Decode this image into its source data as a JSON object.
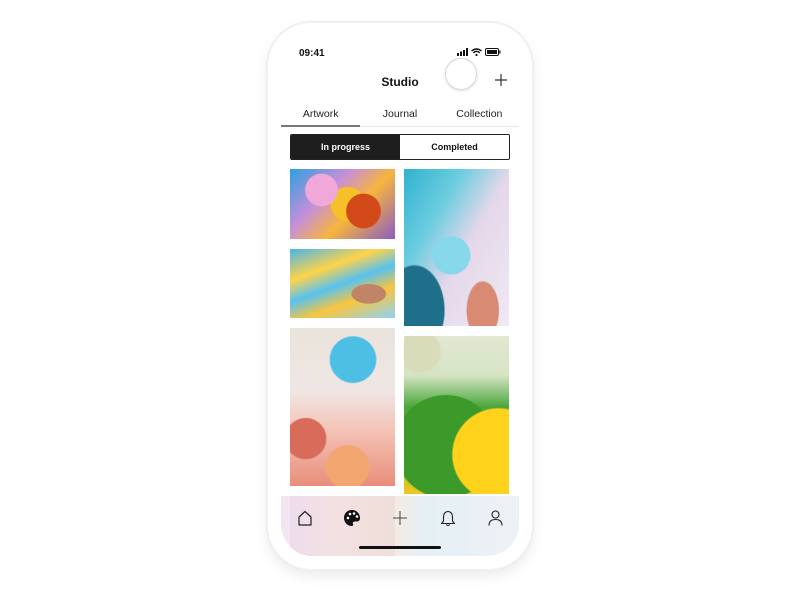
{
  "status_bar": {
    "time": "09:41"
  },
  "navbar": {
    "title": "Studio",
    "add_icon": "plus-icon"
  },
  "tabs": [
    {
      "label": "Artwork",
      "active": true
    },
    {
      "label": "Journal",
      "active": false
    },
    {
      "label": "Collection",
      "active": false
    }
  ],
  "segmented_control": {
    "options": [
      {
        "label": "In progress",
        "active": true
      },
      {
        "label": "Completed",
        "active": false
      }
    ]
  },
  "gallery": {
    "items": [
      {
        "description": "colorful oil bubbles pink yellow blue"
      },
      {
        "description": "blue and yellow liquid waves"
      },
      {
        "description": "teal bubble on pale background"
      },
      {
        "description": "blue and coral bubbles"
      },
      {
        "description": "green and yellow oil bubble"
      },
      {
        "description": "purple pink partial artwork"
      }
    ]
  },
  "tab_bar": {
    "items": [
      {
        "icon": "home-icon",
        "active": false
      },
      {
        "icon": "palette-icon",
        "active": true
      },
      {
        "icon": "plus-icon",
        "active": false
      },
      {
        "icon": "bell-icon",
        "active": false
      },
      {
        "icon": "profile-icon",
        "active": false
      }
    ]
  }
}
